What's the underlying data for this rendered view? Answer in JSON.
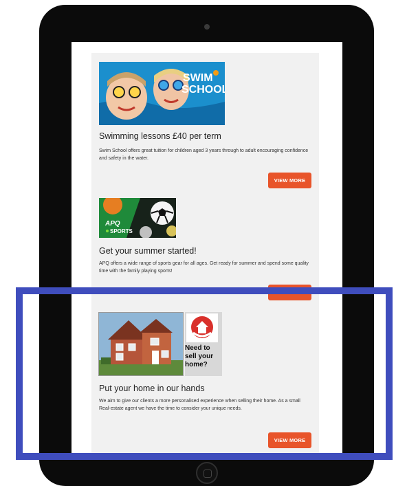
{
  "cards": [
    {
      "image_text_1": "SWIM",
      "image_text_2": "SCHOOL",
      "title": "Swimming lessons £40 per term",
      "description": "Swim School offers great tuition for children aged 3 years through to adult encouraging confidence and safety in the water.",
      "button_label": "VIEW MORE"
    },
    {
      "image_text_1": "APQ",
      "image_text_2": "SPORTS",
      "title": "Get your summer started!",
      "description": "APQ offers a wide range of sports gear for all ages. Get ready for summer and spend some quality time with the family playing sports!",
      "button_label": "VIEW MORE"
    },
    {
      "image_text": "Need to sell your home?",
      "title": "Put your home in our hands",
      "description": "We aim to give our clients a more personalised experience when selling their home. As a small Real-estate agent we have the time to consider your unique needs.",
      "button_label": "VIEW MORE"
    }
  ],
  "colors": {
    "accent": "#e8542a",
    "highlight": "#3f4dbd",
    "tablet_frame": "#0b0b0b"
  }
}
